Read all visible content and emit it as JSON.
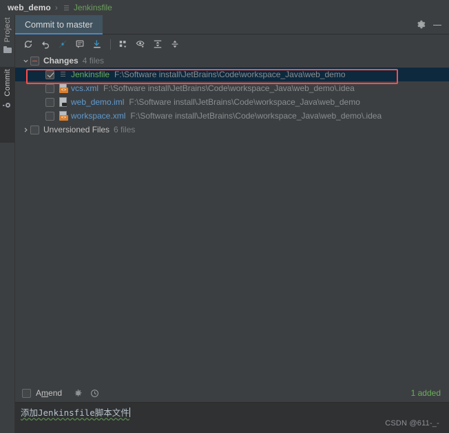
{
  "breadcrumb": {
    "project": "web_demo",
    "separator": "›",
    "file": "Jenkinsfile",
    "file_icon": "script-file-icon"
  },
  "toolstrip": {
    "items": [
      {
        "label": "Project",
        "icon": "folder-icon",
        "active": false
      },
      {
        "label": "Commit",
        "icon": "commit-icon",
        "active": true
      }
    ]
  },
  "tabbar": {
    "active_tab": "Commit to master",
    "icons": [
      {
        "name": "gear-icon",
        "tooltip": "Settings"
      },
      {
        "name": "minimize-icon",
        "tooltip": "Hide"
      }
    ]
  },
  "toolbar": {
    "actions": [
      {
        "name": "refresh-changes-icon",
        "tooltip": "Refresh Changes"
      },
      {
        "name": "rollback-icon",
        "tooltip": "Rollback"
      },
      {
        "name": "shelve-silently-icon",
        "tooltip": "Shelve Silently"
      },
      {
        "name": "show-diff-preview-icon",
        "tooltip": "Show Diff Preview"
      },
      {
        "name": "update-project-icon",
        "tooltip": "Update Project"
      },
      {
        "name": "group-by-icon",
        "tooltip": "Group By"
      },
      {
        "name": "preview-diff-icon",
        "tooltip": "Preview Diff"
      },
      {
        "name": "expand-all-icon",
        "tooltip": "Expand All"
      },
      {
        "name": "collapse-all-icon",
        "tooltip": "Collapse All"
      }
    ]
  },
  "changes_tree": {
    "changes_node": {
      "title": "Changes",
      "count": "4 files",
      "checkbox_state": "partial",
      "expanded": true
    },
    "files": [
      {
        "name": "Jenkinsfile",
        "path": "F:\\Software install\\JetBrains\\Code\\workspace_Java\\web_demo",
        "status": "added",
        "checked": true,
        "selected": true,
        "icon": "script-file-icon"
      },
      {
        "name": "vcs.xml",
        "path": "F:\\Software install\\JetBrains\\Code\\workspace_Java\\web_demo\\.idea",
        "status": "modified",
        "checked": false,
        "selected": false,
        "icon": "xml-file-icon"
      },
      {
        "name": "web_demo.iml",
        "path": "F:\\Software install\\JetBrains\\Code\\workspace_Java\\web_demo",
        "status": "modified",
        "checked": false,
        "selected": false,
        "icon": "iml-file-icon"
      },
      {
        "name": "workspace.xml",
        "path": "F:\\Software install\\JetBrains\\Code\\workspace_Java\\web_demo\\.idea",
        "status": "modified",
        "checked": false,
        "selected": false,
        "icon": "xml-file-icon"
      }
    ],
    "unversioned_node": {
      "title": "Unversioned Files",
      "count": "6 files",
      "checkbox_state": "unchecked",
      "expanded": false
    }
  },
  "bottom_bar": {
    "amend_label_pre": "A",
    "amend_label_accel": "m",
    "amend_label_post": "end",
    "amend_checked": false,
    "icons": [
      {
        "name": "commit-options-gear-icon"
      },
      {
        "name": "commit-history-icon"
      }
    ],
    "status": "1 added"
  },
  "commit_message": {
    "text_spellchecked": "添加Jenkinsfile脚本文件",
    "watermark": "CSDN @611-_-"
  },
  "colors": {
    "panel_bg": "#3c3f41",
    "selection_bg": "#0d293e",
    "tab_bg": "#41535f",
    "tab_underline": "#4a88c7",
    "added_green": "#6cae5c",
    "modified_blue": "#5f9bd1",
    "annotation_red": "#ff4d4d",
    "accent_blue": "#4a88c7"
  }
}
